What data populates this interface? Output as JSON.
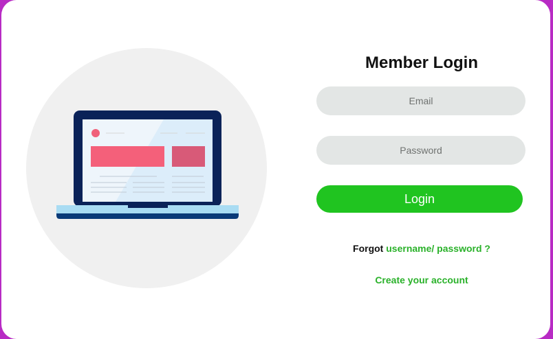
{
  "login": {
    "title": "Member Login",
    "email_placeholder": "Email",
    "password_placeholder": "Password",
    "submit_label": "Login",
    "forgot_prefix": "Forgot",
    "forgot_link": "username/ password ?",
    "create_account": "Create your account"
  },
  "colors": {
    "page_border": "#b82bc4",
    "accent": "#20c420",
    "link": "#29b129",
    "field_bg": "#e3e6e5"
  }
}
